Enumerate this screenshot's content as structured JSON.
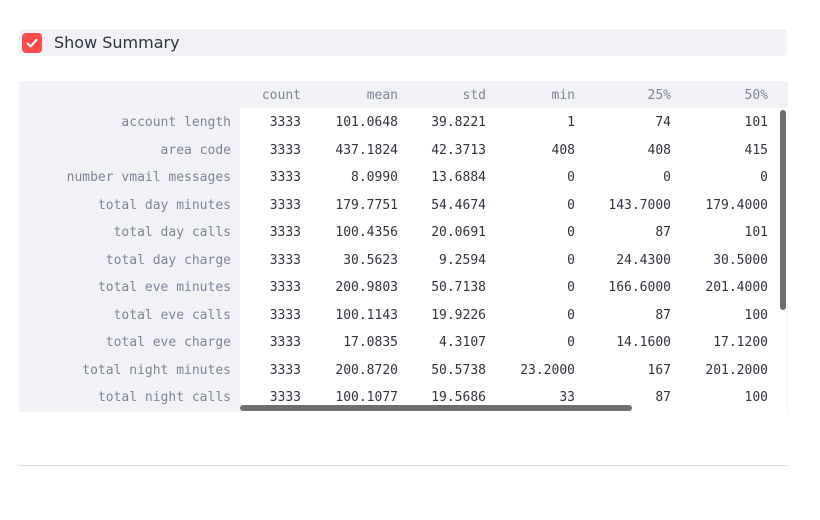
{
  "summary_toggle": {
    "label": "Show Summary",
    "checked": true,
    "accent_color": "#ff4b4b"
  },
  "table": {
    "columns": [
      "count",
      "mean",
      "std",
      "min",
      "25%",
      "50%"
    ],
    "rows": [
      {
        "label": "account length",
        "values": [
          "3333",
          "101.0648",
          "39.8221",
          "1",
          "74",
          "101"
        ]
      },
      {
        "label": "area code",
        "values": [
          "3333",
          "437.1824",
          "42.3713",
          "408",
          "408",
          "415"
        ]
      },
      {
        "label": "number vmail messages",
        "values": [
          "3333",
          "8.0990",
          "13.6884",
          "0",
          "0",
          "0"
        ]
      },
      {
        "label": "total day minutes",
        "values": [
          "3333",
          "179.7751",
          "54.4674",
          "0",
          "143.7000",
          "179.4000"
        ]
      },
      {
        "label": "total day calls",
        "values": [
          "3333",
          "100.4356",
          "20.0691",
          "0",
          "87",
          "101"
        ]
      },
      {
        "label": "total day charge",
        "values": [
          "3333",
          "30.5623",
          "9.2594",
          "0",
          "24.4300",
          "30.5000"
        ]
      },
      {
        "label": "total eve minutes",
        "values": [
          "3333",
          "200.9803",
          "50.7138",
          "0",
          "166.6000",
          "201.4000"
        ]
      },
      {
        "label": "total eve calls",
        "values": [
          "3333",
          "100.1143",
          "19.9226",
          "0",
          "87",
          "100"
        ]
      },
      {
        "label": "total eve charge",
        "values": [
          "3333",
          "17.0835",
          "4.3107",
          "0",
          "14.1600",
          "17.1200"
        ]
      },
      {
        "label": "total night minutes",
        "values": [
          "3333",
          "200.8720",
          "50.5738",
          "23.2000",
          "167",
          "201.2000"
        ]
      },
      {
        "label": "total night calls",
        "values": [
          "3333",
          "100.1077",
          "19.5686",
          "33",
          "87",
          "100"
        ]
      }
    ]
  }
}
